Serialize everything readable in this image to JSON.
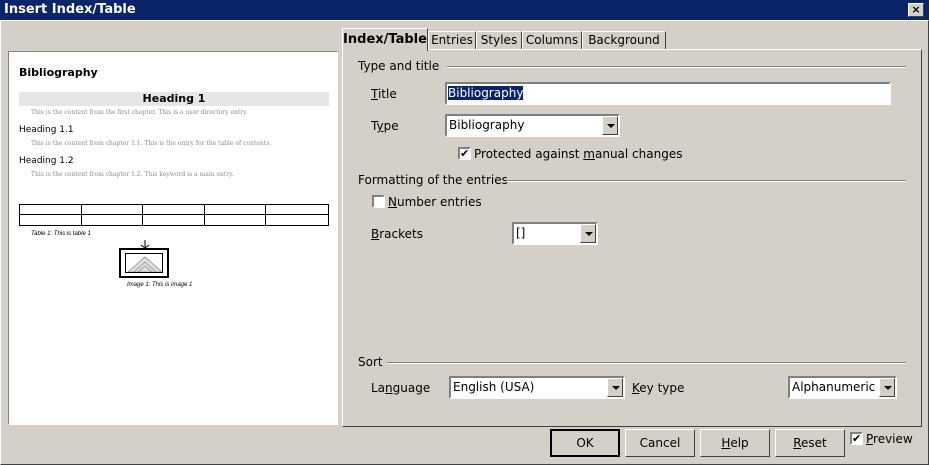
{
  "window": {
    "title": "Insert Index/Table",
    "close_glyph": "×"
  },
  "preview": {
    "title": "Bibliography",
    "heading1": "Heading 1",
    "text1": "This is the content from the first chapter. This is a user directory entry.",
    "heading11": "Heading 1.1",
    "text11": "This is the content from chapter 1.1. This is the entry for the table of contents.",
    "heading12": "Heading 1.2",
    "text12": "This is the content from chapter 1.2. This keyword is a main entry.",
    "table_caption": "Table 1: This is table 1",
    "image_caption": "Image 1: This is image 1"
  },
  "tabs": [
    {
      "label": "Index/Table",
      "active": true
    },
    {
      "label": "Entries",
      "active": false
    },
    {
      "label": "Styles",
      "active": false
    },
    {
      "label": "Columns",
      "active": false
    },
    {
      "label": "Background",
      "active": false
    }
  ],
  "type_and_title": {
    "group_label": "Type and title",
    "title_label_accel": "T",
    "title_label_rest": "itle",
    "title_value": "Bibliography",
    "type_label_pre": "T",
    "type_label_accel": "y",
    "type_label_rest": "pe",
    "type_value": "Bibliography",
    "protected_pre": "Protected against ",
    "protected_accel": "m",
    "protected_rest": "anual changes",
    "protected_checked": true
  },
  "formatting": {
    "group_label": "Formatting of the entries",
    "number_entries_accel": "N",
    "number_entries_rest": "umber entries",
    "number_entries_checked": false,
    "brackets_accel": "B",
    "brackets_rest": "rackets",
    "brackets_value": "[]"
  },
  "sort": {
    "group_label": "Sort",
    "language_pre": "La",
    "language_accel": "n",
    "language_rest": "guage",
    "language_value": "English (USA)",
    "key_type_accel": "K",
    "key_type_rest": "ey type",
    "key_type_value": "Alphanumeric"
  },
  "buttons": {
    "ok": "OK",
    "cancel": "Cancel",
    "help_accel": "H",
    "help_rest": "elp",
    "reset_accel": "R",
    "reset_rest": "eset",
    "preview_accel": "P",
    "preview_rest": "review",
    "preview_checked": true
  },
  "check_glyph": "✔"
}
